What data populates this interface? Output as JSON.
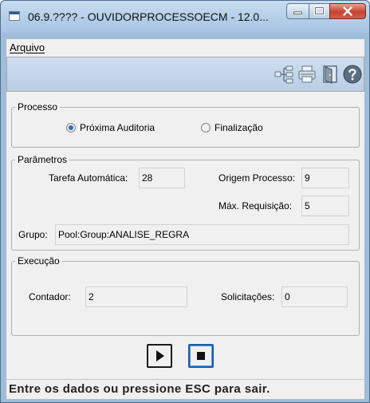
{
  "window": {
    "title": "06.9.???? - OUVIDORPROCESSOECM - 12.0...",
    "controls": {
      "minimize": "minimize-icon",
      "maximize": "maximize-icon",
      "close": "close-icon"
    }
  },
  "menu": {
    "items": [
      {
        "label": "Arquivo"
      }
    ]
  },
  "toolbar": {
    "icons": [
      "tree-structure-icon",
      "printer-icon",
      "exit-door-icon",
      "help-icon"
    ]
  },
  "processo": {
    "legend": "Processo",
    "options": [
      {
        "label": "Próxima Auditoria",
        "selected": true
      },
      {
        "label": "Finalização",
        "selected": false
      }
    ]
  },
  "parametros": {
    "legend": "Parâmetros",
    "tarefa_automatica": {
      "label": "Tarefa Automática:",
      "value": "28"
    },
    "origem_processo": {
      "label": "Origem Processo:",
      "value": "9"
    },
    "max_requisicao": {
      "label": "Máx. Requisição:",
      "value": "5"
    },
    "grupo": {
      "label": "Grupo:",
      "value": "Pool:Group:ANALISE_REGRA"
    }
  },
  "execucao": {
    "legend": "Execução",
    "contador": {
      "label": "Contador:",
      "value": "2"
    },
    "solicitacoes": {
      "label": "Solicitações:",
      "value": "0"
    }
  },
  "controls": {
    "play": "play-icon",
    "stop": "stop-icon"
  },
  "status": {
    "text": "Entre os dados ou pressione ESC para sair."
  }
}
